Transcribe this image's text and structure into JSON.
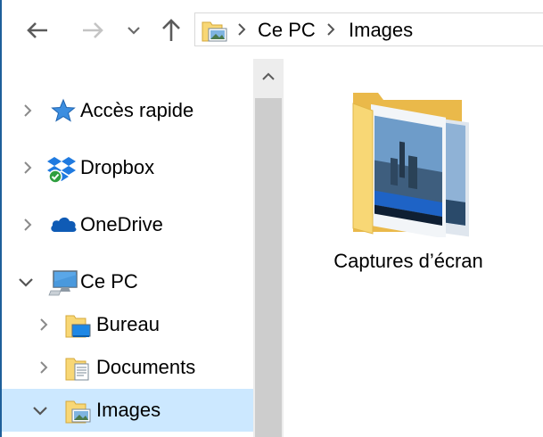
{
  "toolbar": {
    "back_icon": "arrow-left-icon",
    "forward_icon": "arrow-right-icon",
    "recent_icon": "chevron-down-icon",
    "up_icon": "arrow-up-icon"
  },
  "address": {
    "breadcrumb": [
      "Ce PC",
      "Images"
    ],
    "folder_icon": "pictures-folder-icon",
    "separator_icon": "chevron-right-icon"
  },
  "nav": {
    "items": [
      {
        "label": "Accès rapide",
        "icon": "star-icon",
        "expanded": false
      },
      {
        "label": "Dropbox",
        "icon": "dropbox-icon",
        "expanded": false
      },
      {
        "label": "OneDrive",
        "icon": "cloud-icon",
        "expanded": false
      },
      {
        "label": "Ce PC",
        "icon": "computer-icon",
        "expanded": true
      },
      {
        "label": "Bureau",
        "icon": "desktop-folder-icon",
        "expanded": false
      },
      {
        "label": "Documents",
        "icon": "documents-folder-icon",
        "expanded": false
      },
      {
        "label": "Images",
        "icon": "pictures-folder-icon",
        "expanded": true,
        "selected": true
      }
    ]
  },
  "content": {
    "items": [
      {
        "label": "Captures d’écran",
        "icon": "screenshots-folder-icon"
      }
    ]
  },
  "colors": {
    "selection": "#cce8ff",
    "folder": "#f8d775",
    "accent": "#1e5f9a"
  }
}
